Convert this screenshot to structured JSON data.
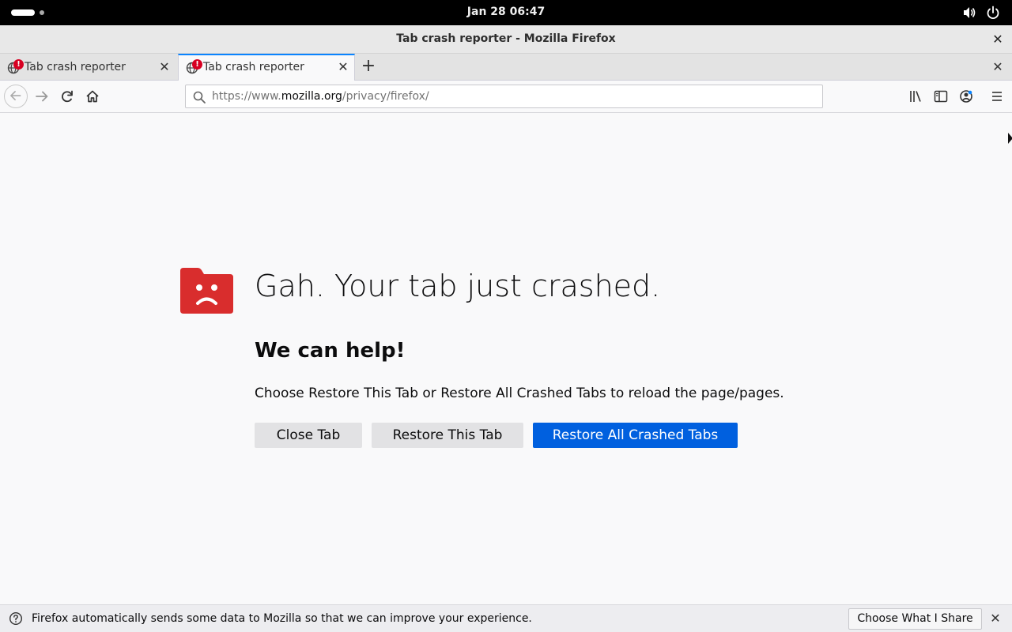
{
  "system": {
    "clock": "Jan 28  06:47"
  },
  "window": {
    "title": "Tab crash reporter - Mozilla Firefox",
    "close_glyph": "✕"
  },
  "tabs": [
    {
      "label": "Tab crash reporter",
      "active": false,
      "badge": "!"
    },
    {
      "label": "Tab crash reporter",
      "active": true,
      "badge": "!"
    }
  ],
  "tabstrip": {
    "new_tab_glyph": "+",
    "close_glyph": "✕",
    "tab_close_glyph": "✕"
  },
  "urlbar": {
    "prefix": "https://www.",
    "host": "mozilla.org",
    "path": "/privacy/firefox/"
  },
  "crash_page": {
    "title": "Gah. Your tab just crashed.",
    "help_heading": "We can help!",
    "help_text": "Choose Restore This Tab or Restore All Crashed Tabs to reload the page/pages.",
    "buttons": {
      "close_tab": "Close Tab",
      "restore_this": "Restore This Tab",
      "restore_all": "Restore All Crashed Tabs"
    }
  },
  "notification": {
    "text": "Firefox automatically sends some data to Mozilla so that we can improve your experience.",
    "button": "Choose What I Share",
    "close_glyph": "✕"
  },
  "colors": {
    "accent": "#0060df",
    "tab_highlight": "#0a84ff",
    "crash_icon": "#d92d2d",
    "badge": "#d70022"
  }
}
